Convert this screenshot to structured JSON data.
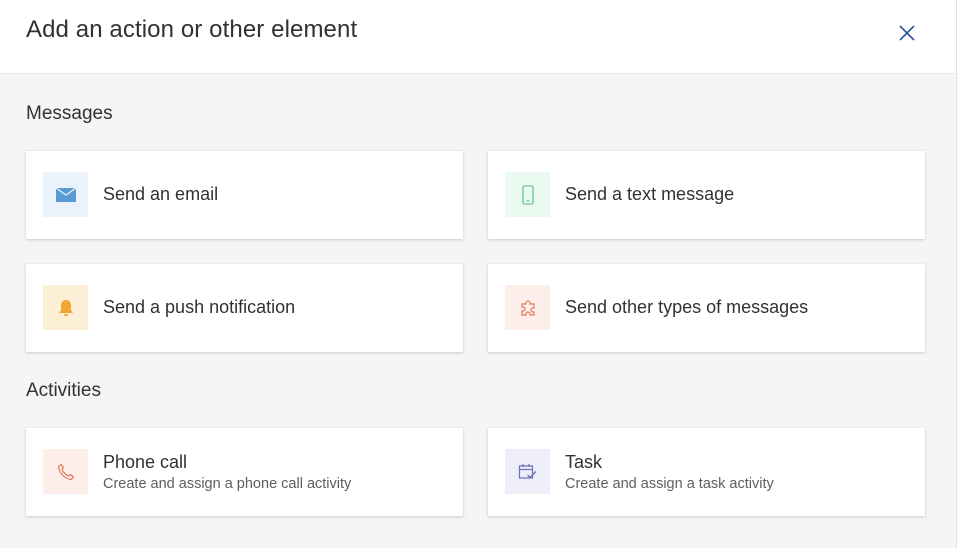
{
  "dialog": {
    "title": "Add an action or other element",
    "close_icon": "close-icon"
  },
  "sections": {
    "messages": {
      "label": "Messages",
      "cards": [
        {
          "label": "Send an email",
          "icon": "mail-icon",
          "icon_bg": "#eaf3fc",
          "icon_color": "#5b9bd5"
        },
        {
          "label": "Send a text message",
          "icon": "phone-icon",
          "icon_bg": "#eafaf0",
          "icon_color": "#6cc58f"
        },
        {
          "label": "Send a push notification",
          "icon": "bell-icon",
          "icon_bg": "#fdefd6",
          "icon_color": "#f0a830"
        },
        {
          "label": "Send other types of messages",
          "icon": "puzzle-icon",
          "icon_bg": "#fdeee9",
          "icon_color": "#e07a5f"
        }
      ]
    },
    "activities": {
      "label": "Activities",
      "cards": [
        {
          "label": "Phone call",
          "description": "Create and assign a phone call activity",
          "icon": "phone-call-icon",
          "icon_bg": "#fdeee9",
          "icon_color": "#e07a5f"
        },
        {
          "label": "Task",
          "description": "Create and assign a task activity",
          "icon": "task-icon",
          "icon_bg": "#eeeef9",
          "icon_color": "#6b6fb5"
        }
      ]
    }
  }
}
